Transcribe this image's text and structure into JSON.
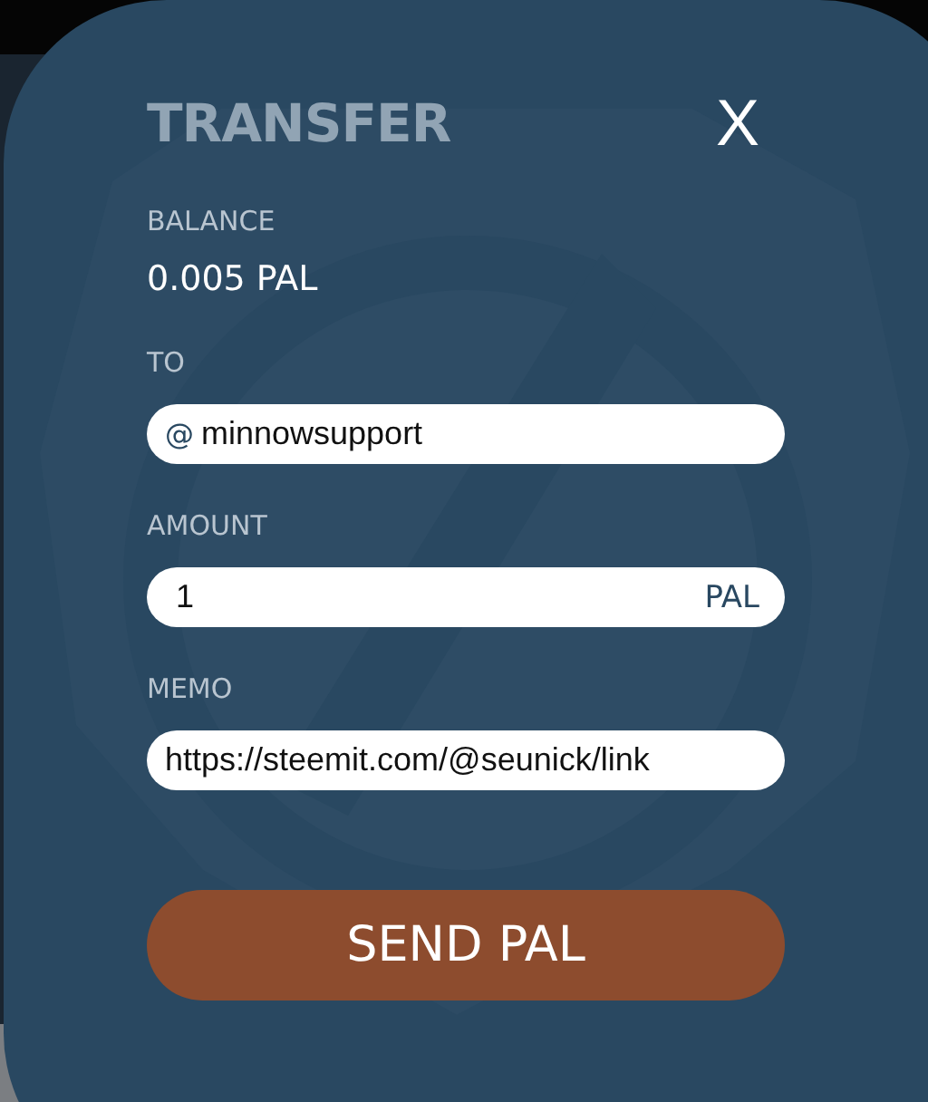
{
  "dialog": {
    "title": "TRANSFER",
    "close": "X",
    "balance": {
      "label": "BALANCE",
      "value": "0.005 PAL"
    },
    "fields": [
      {
        "kind": "prefix",
        "label": "TO",
        "prefix": "@",
        "value": "minnowsupport"
      },
      {
        "kind": "suffix",
        "label": "AMOUNT",
        "value": "1",
        "suffix": "PAL"
      },
      {
        "kind": "plain",
        "label": "MEMO",
        "value": "https://steemit.com/@seunick/link"
      }
    ],
    "submit": "SEND PAL"
  }
}
